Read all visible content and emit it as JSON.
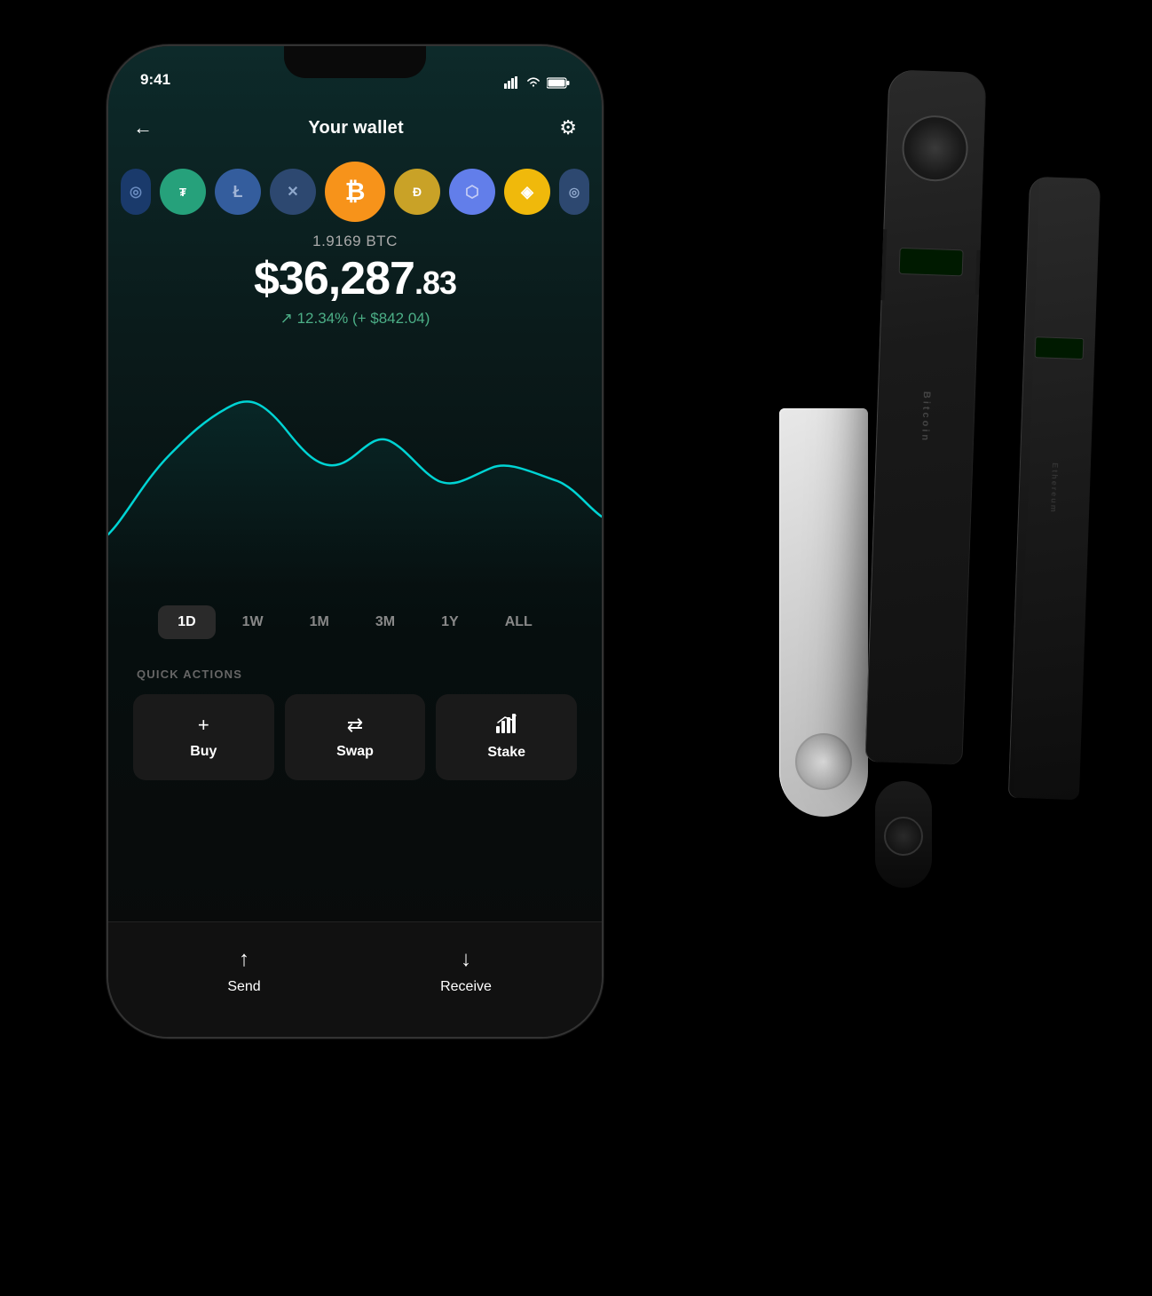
{
  "status_bar": {
    "time": "9:41",
    "signal_icon": "signal-bars",
    "wifi_icon": "wifi-icon",
    "battery_icon": "battery-icon"
  },
  "header": {
    "back_label": "←",
    "title": "Your wallet",
    "settings_label": "⚙"
  },
  "coins": [
    {
      "symbol": "◎",
      "name": "algo",
      "class": "coin-algo",
      "label": "ALGO"
    },
    {
      "symbol": "₮",
      "name": "usdt",
      "class": "coin-usdt",
      "label": "USDT"
    },
    {
      "symbol": "Ł",
      "name": "ltc",
      "class": "coin-ltc",
      "label": "LTC"
    },
    {
      "symbol": "✕",
      "name": "xrp",
      "class": "coin-xrp",
      "label": "XRP"
    },
    {
      "symbol": "₿",
      "name": "btc",
      "class": "coin-btc",
      "label": "BTC",
      "active": true
    },
    {
      "symbol": "Ð",
      "name": "doge",
      "class": "coin-doge",
      "label": "DOGE"
    },
    {
      "symbol": "⬡",
      "name": "eth",
      "class": "coin-eth",
      "label": "ETH"
    },
    {
      "symbol": "◈",
      "name": "bnb",
      "class": "coin-bnb",
      "label": "BNB"
    }
  ],
  "balance": {
    "crypto_amount": "1.9169 BTC",
    "usd_main": "$36,287",
    "usd_cents": ".83",
    "change_percent": "12.34%",
    "change_usd": "+ $842.04",
    "change_arrow": "↗"
  },
  "chart": {
    "color": "#00d4d4"
  },
  "time_filters": [
    {
      "label": "1D",
      "active": true
    },
    {
      "label": "1W",
      "active": false
    },
    {
      "label": "1M",
      "active": false
    },
    {
      "label": "3M",
      "active": false
    },
    {
      "label": "1Y",
      "active": false
    },
    {
      "label": "ALL",
      "active": false
    }
  ],
  "quick_actions": {
    "section_label": "QUICK ACTIONS",
    "buttons": [
      {
        "icon": "+",
        "label": "Buy",
        "name": "buy-button"
      },
      {
        "icon": "⇄",
        "label": "Swap",
        "name": "swap-button"
      },
      {
        "icon": "↑↑",
        "label": "Stake",
        "name": "stake-button"
      }
    ]
  },
  "bottom_actions": [
    {
      "icon": "↑",
      "label": "Send",
      "name": "send-button"
    },
    {
      "icon": "↓",
      "label": "Receive",
      "name": "receive-button"
    }
  ],
  "ledger_devices": {
    "nano_x_label": "Bitcoin",
    "nano_s_label": "Ethereum"
  }
}
